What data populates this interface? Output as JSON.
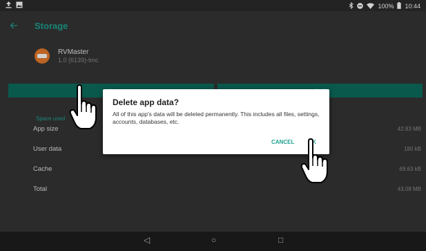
{
  "status_bar": {
    "left_icons": [
      "upload-icon",
      "image-icon"
    ],
    "right_icons": [
      "bluetooth-icon",
      "dnd-icon",
      "wifi-icon"
    ],
    "battery": "100%",
    "time": "10:44"
  },
  "header": {
    "title": "Storage"
  },
  "app": {
    "name": "RVMaster",
    "version": "1.0 (6139)-tmc"
  },
  "buttons": {
    "left_visible": "CL",
    "right_visible": "CHE"
  },
  "section_label": "Space used",
  "rows": [
    {
      "label": "App size",
      "value": "42.83 MB"
    },
    {
      "label": "User data",
      "value": "180 kB"
    },
    {
      "label": "Cache",
      "value": "69.63 kB"
    },
    {
      "label": "Total",
      "value": "43.08 MB"
    }
  ],
  "dialog": {
    "title": "Delete app data?",
    "body": "All of this app's data will be deleted permanently. This includes all files, settings, accounts, databases, etc.",
    "cancel": "CANCEL",
    "ok": "OK"
  },
  "nav": {
    "back": "◁",
    "home": "○",
    "recents": "□"
  },
  "colors": {
    "accent": "#1fa191",
    "button_bar": "#0d6d5f",
    "background": "#353535",
    "logo": "#e87a2b"
  }
}
